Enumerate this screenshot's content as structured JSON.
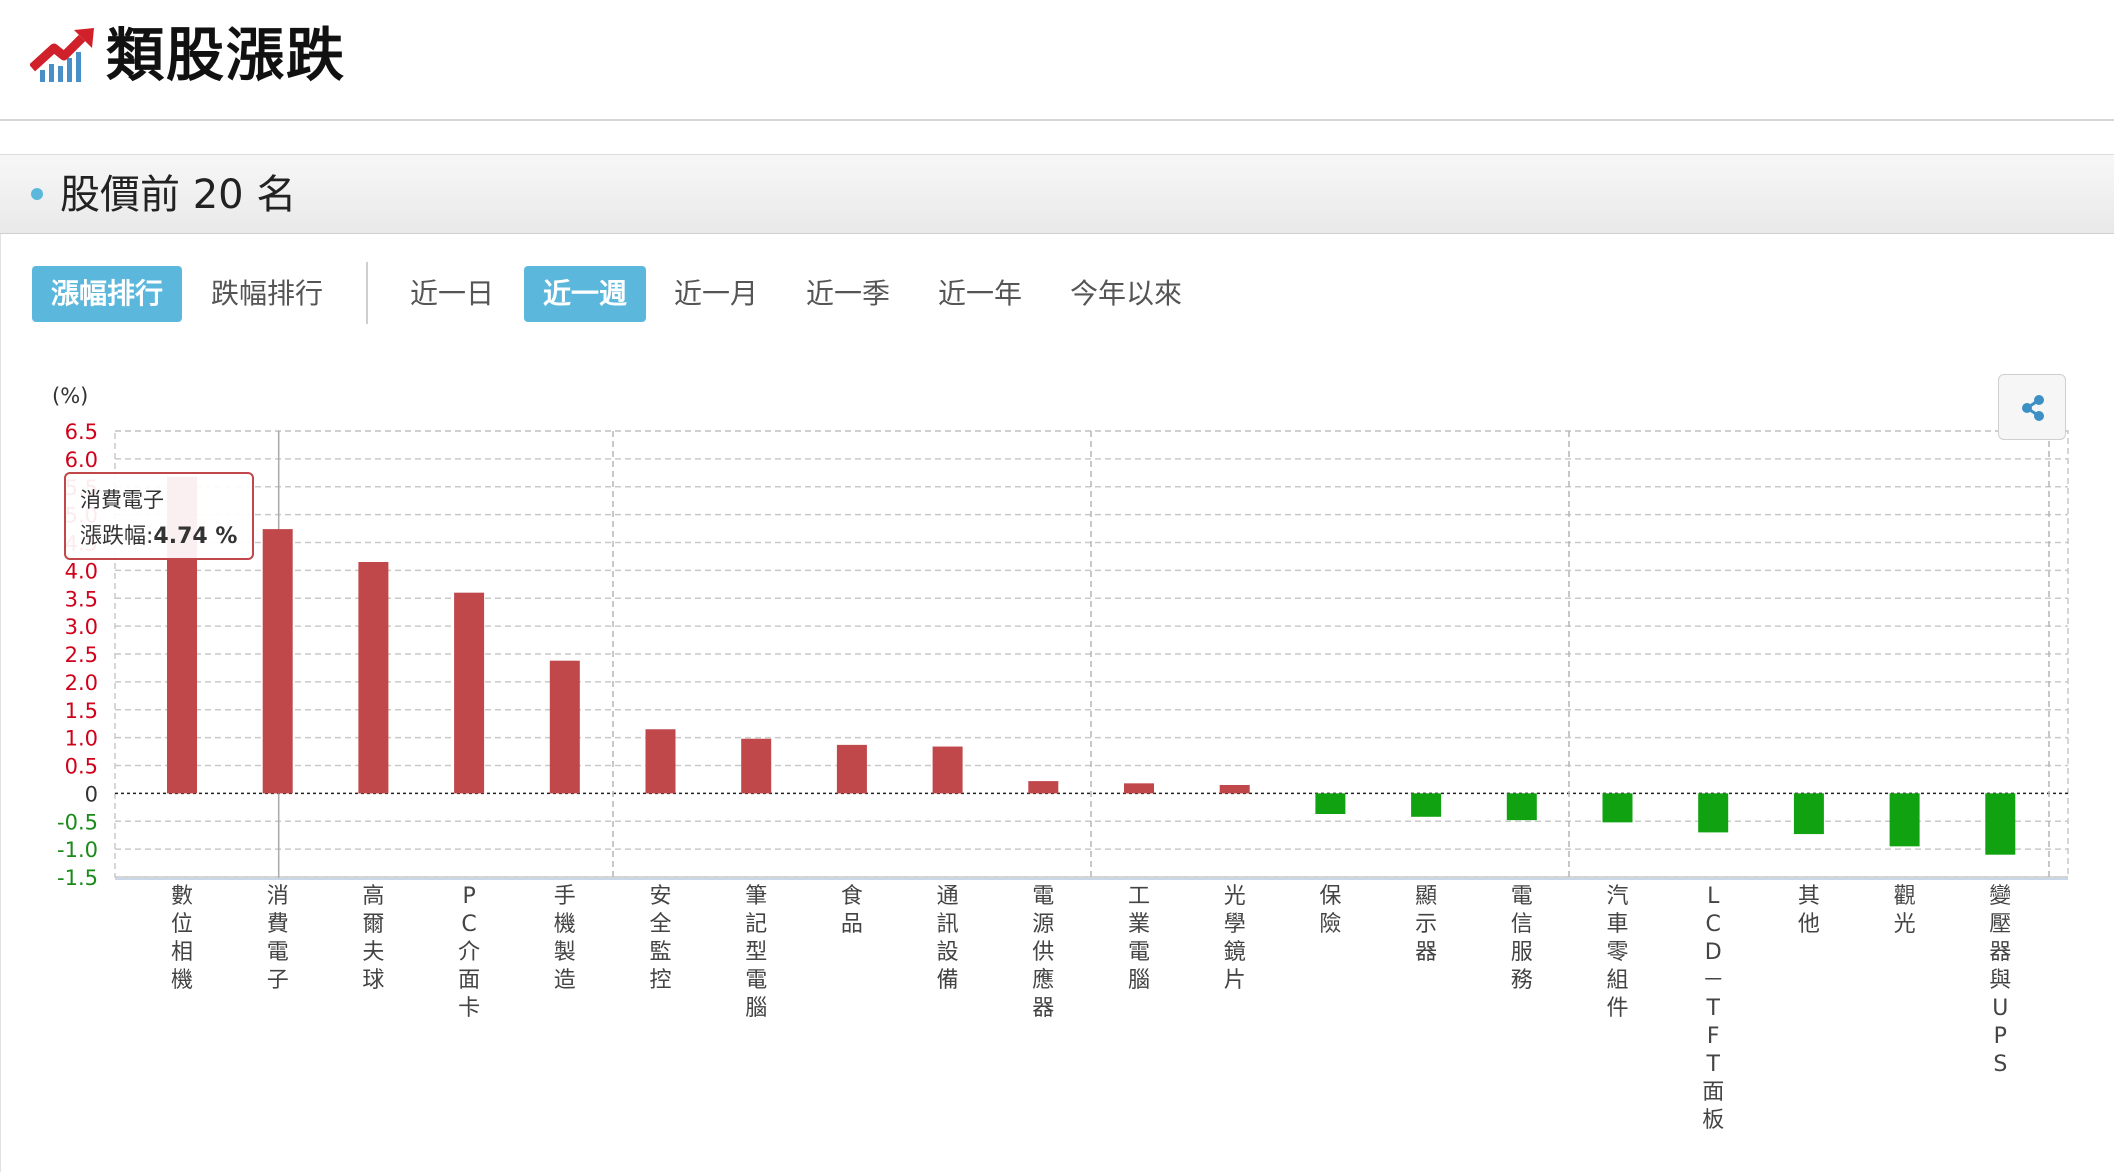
{
  "header": {
    "title": "類股漲跌",
    "logo_icon": "rising-chart-icon"
  },
  "section": {
    "title": "股價前 20 名"
  },
  "rank_tabs": [
    {
      "label": "漲幅排行",
      "active": true
    },
    {
      "label": "跌幅排行",
      "active": false
    }
  ],
  "period_tabs": [
    {
      "label": "近一日",
      "active": false
    },
    {
      "label": "近一週",
      "active": true
    },
    {
      "label": "近一月",
      "active": false
    },
    {
      "label": "近一季",
      "active": false
    },
    {
      "label": "近一年",
      "active": false
    },
    {
      "label": "今年以來",
      "active": false
    }
  ],
  "share_icon": "share-icon",
  "tooltip": {
    "category": "消費電子",
    "label": "漲跌幅:",
    "value": "4.74 %"
  },
  "colors": {
    "accent": "#5bb8dc",
    "positive": "#c0474a",
    "negative": "#11a211",
    "positive_tick": "#d0021b",
    "negative_tick": "#1a8a1a"
  },
  "chart_data": {
    "type": "bar",
    "ylabel": "(%)",
    "ylim": [
      -1.5,
      6.5
    ],
    "yticks": [
      "6.5",
      "6.0",
      "5.5",
      "5.0",
      "4.5",
      "4.0",
      "3.5",
      "3.0",
      "2.5",
      "2.0",
      "1.5",
      "1.0",
      "0.5",
      "0",
      "-0.5",
      "-1.0",
      "-1.5"
    ],
    "categories": [
      "數位相機",
      "消費電子",
      "高爾夫球",
      "PC介面卡",
      "手機製造",
      "安全監控",
      "筆記型電腦",
      "食品",
      "通訊設備",
      "電源供應器",
      "工業電腦",
      "光學鏡片",
      "保險",
      "顯示器",
      "電信服務",
      "汽車零組件",
      "LCD－TFT面板",
      "其他",
      "觀光",
      "變壓器與UPS"
    ],
    "values": [
      5.68,
      4.74,
      4.15,
      3.6,
      2.38,
      1.15,
      0.98,
      0.87,
      0.84,
      0.22,
      0.18,
      0.15,
      -0.37,
      -0.42,
      -0.48,
      -0.52,
      -0.7,
      -0.73,
      -0.95,
      -1.1
    ],
    "grid": true,
    "legend": "none"
  }
}
